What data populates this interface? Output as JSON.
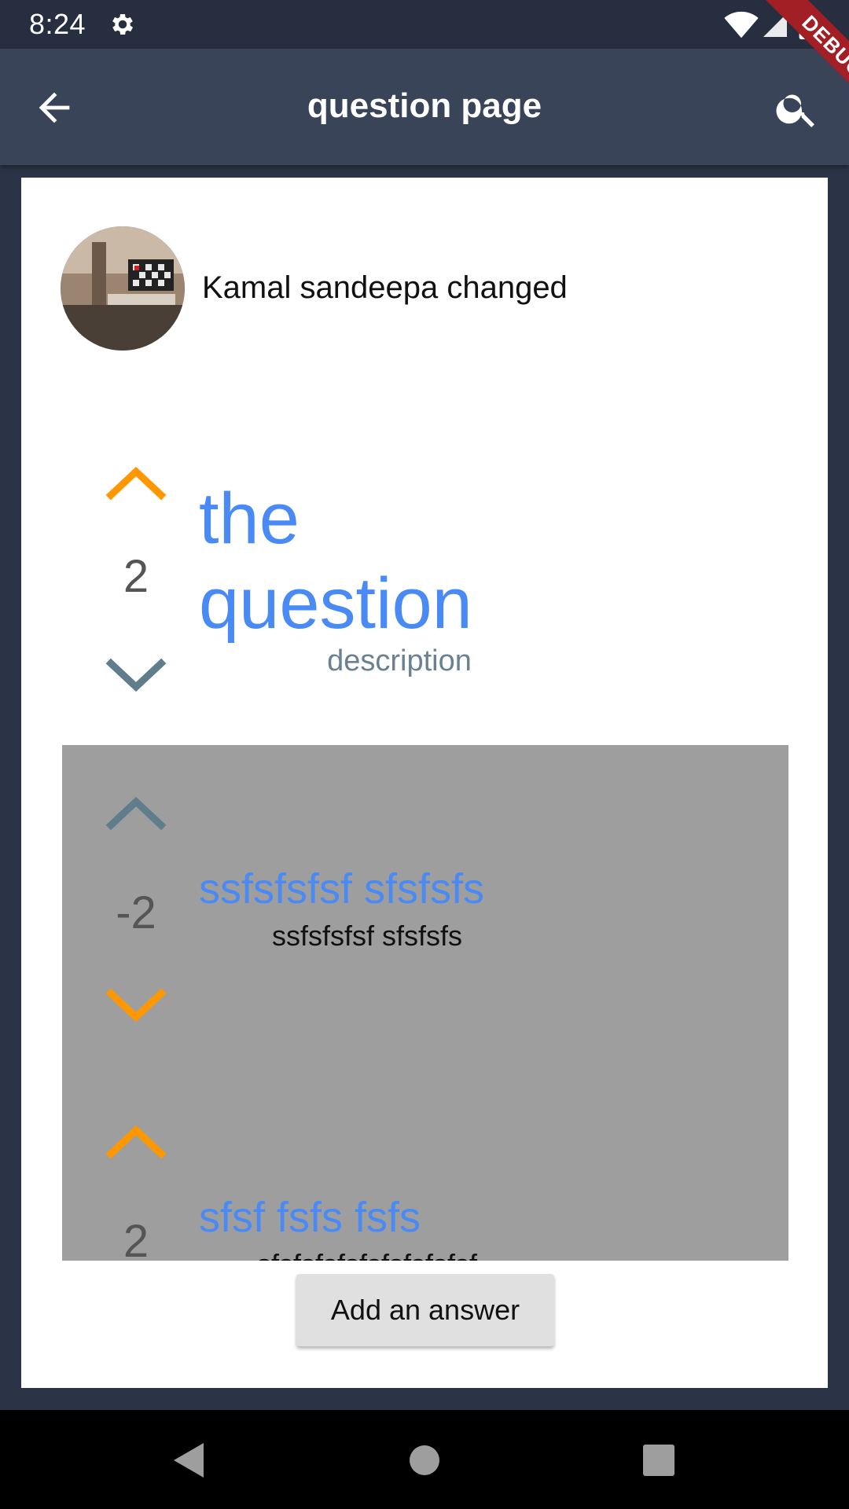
{
  "status_bar": {
    "time": "8:24",
    "icons": [
      "settings-icon",
      "wifi-icon",
      "signal-icon",
      "battery-icon"
    ]
  },
  "app_bar": {
    "title": "question page",
    "back_icon": "arrow-back-icon",
    "search_icon": "search-icon"
  },
  "debug_banner": "DEBUG",
  "question": {
    "author": "Kamal sandeepa changed",
    "votes": "2",
    "title_line1": "the",
    "title_line2": "question",
    "description": "description",
    "upvoted": true
  },
  "answers": [
    {
      "votes": "-2",
      "title": "ssfsfsfsf sfsfsfs",
      "body": "ssfsfsfsf sfsfsfs",
      "upvoted": false,
      "downvoted": true
    },
    {
      "votes": "2",
      "title": "sfsf fsfs fsfs",
      "body": "sfsfsfsfsfsfsfsfsfsf",
      "upvoted": true,
      "downvoted": false
    }
  ],
  "actions": {
    "add_answer": "Add an answer"
  },
  "colors": {
    "accent": "#4a8af4",
    "vote_active": "#ff9800",
    "vote_inactive": "#607d8b",
    "app_bar": "#394458",
    "answers_bg": "#9e9e9e"
  },
  "nav_bar": {
    "icons": [
      "back-triangle-icon",
      "home-circle-icon",
      "recents-square-icon"
    ]
  }
}
